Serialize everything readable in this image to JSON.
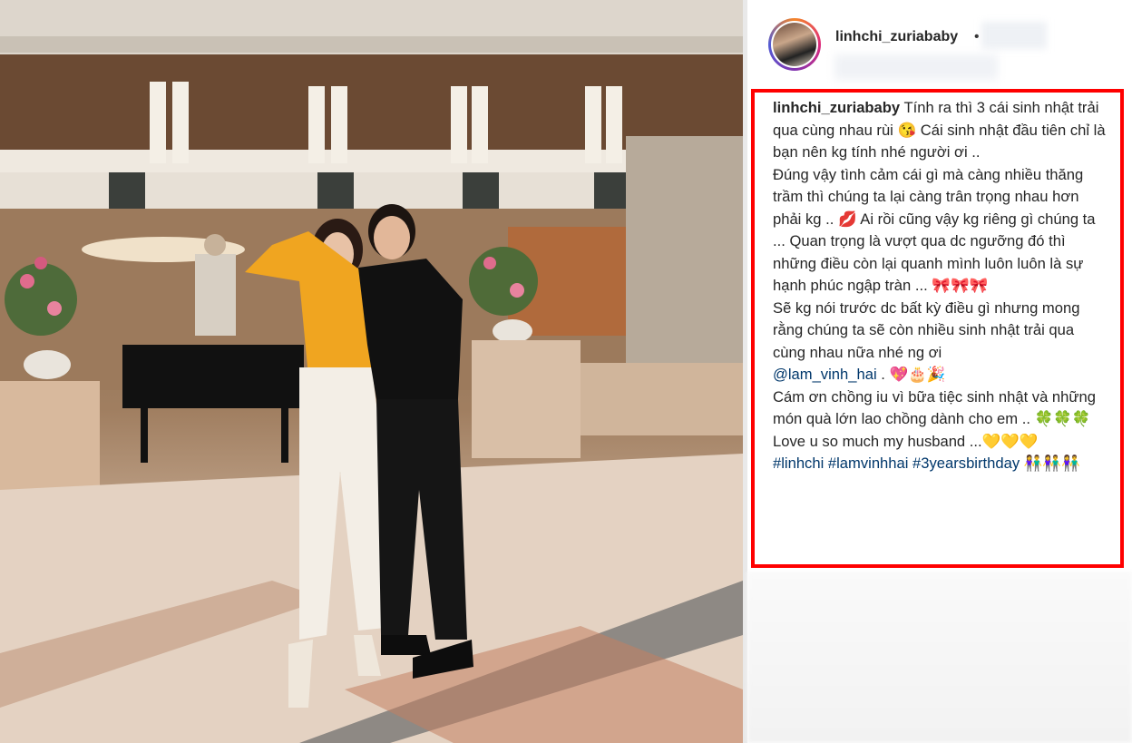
{
  "post": {
    "username": "linhchi_zuriababy",
    "dot": "•"
  },
  "caption": {
    "author": "linhchi_zuriababy",
    "lines": [
      "Tính ra thì 3 cái sinh nhật trải qua cùng nhau rùi 😘 Cái sinh nhật đầu tiên chỉ là bạn nên kg tính nhé người ơi ..",
      "Đúng vậy tình cảm cái gì mà càng nhiều thăng trầm thì chúng ta lại càng trân trọng nhau hơn phải kg .. 💋 Ai rồi cũng vậy kg riêng gì chúng ta ... Quan trọng là vượt qua dc ngưỡng đó thì những điều còn lại quanh mình luôn luôn là sự hạnh phúc ngập tràn ... 🎀🎀🎀",
      "Sẽ kg nói trước dc bất kỳ điều gì nhưng mong rằng chúng ta sẽ còn nhiều sinh nhật trải qua cùng nhau nữa nhé ng ơi",
      "Cám ơn chồng iu vì bữa tiệc sinh nhật và những món quà lớn lao chồng dành cho em .. 🍀🍀🍀",
      "Love u so much my husband ...💛💛💛"
    ],
    "mention": "@lam_vinh_hai",
    "mention_suffix": " . 💖🎂🎉",
    "hashtags": "#linhchi #lamvinhhai #3yearsbirthday",
    "hashtag_suffix": " 👫👫👫"
  },
  "colors": {
    "highlight_border": "#ff0000",
    "link": "#00376b",
    "text": "#262626"
  }
}
